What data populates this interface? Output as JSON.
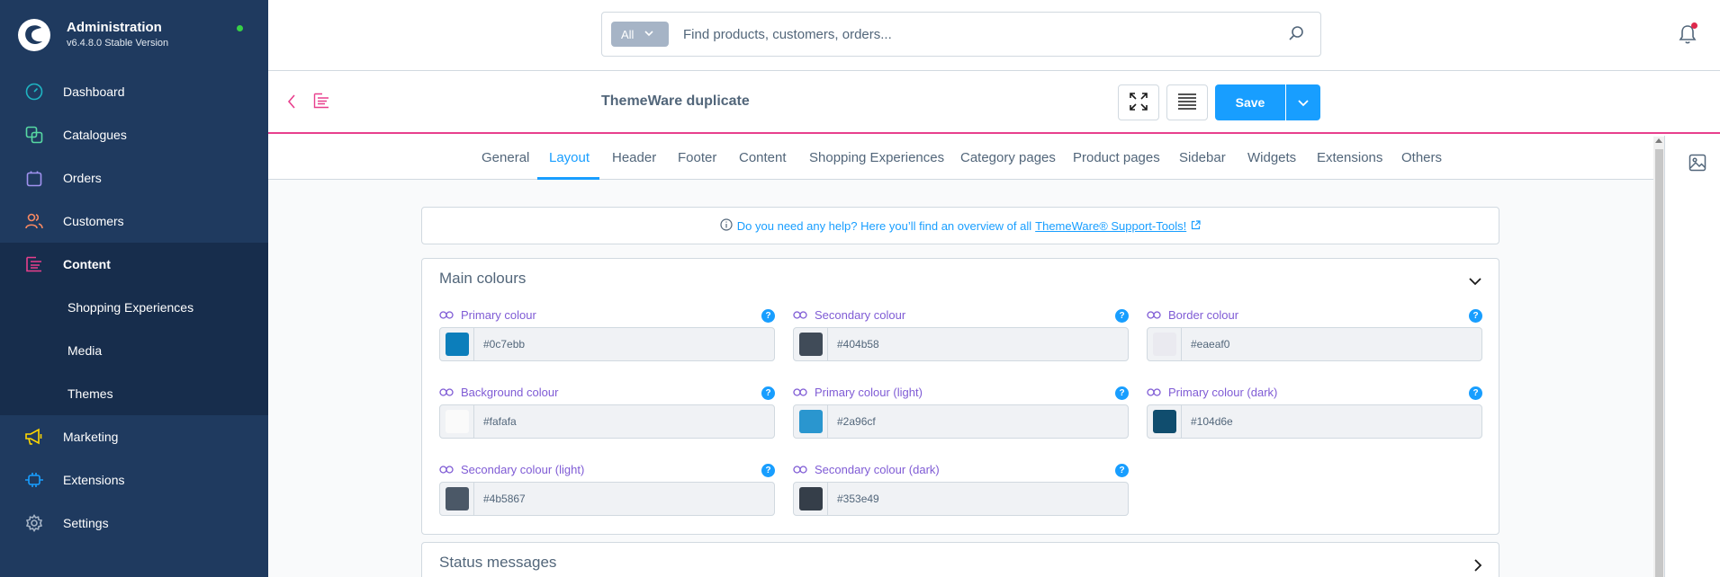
{
  "app": {
    "title": "Administration",
    "version": "v6.4.8.0 Stable Version"
  },
  "sidebar": {
    "items": [
      {
        "label": "Dashboard",
        "icon": "dashboard-icon"
      },
      {
        "label": "Catalogues",
        "icon": "catalogues-icon"
      },
      {
        "label": "Orders",
        "icon": "orders-icon"
      },
      {
        "label": "Customers",
        "icon": "customers-icon"
      },
      {
        "label": "Content",
        "icon": "content-icon"
      },
      {
        "label": "Marketing",
        "icon": "marketing-icon"
      },
      {
        "label": "Extensions",
        "icon": "extensions-icon"
      },
      {
        "label": "Settings",
        "icon": "settings-icon"
      }
    ],
    "content_subitems": [
      "Shopping Experiences",
      "Media",
      "Themes"
    ]
  },
  "search": {
    "scope": "All",
    "placeholder": "Find products, customers, orders..."
  },
  "smartbar": {
    "title": "ThemeWare duplicate",
    "save_label": "Save"
  },
  "tabs": [
    "General",
    "Layout",
    "Header",
    "Footer",
    "Content",
    "Shopping Experiences",
    "Category pages",
    "Product pages",
    "Sidebar",
    "Widgets",
    "Extensions",
    "Others"
  ],
  "active_tab": "Layout",
  "help": {
    "text": "Do you need any help? Here you’ll find an overview of all",
    "link": "ThemeWare® Support-Tools!"
  },
  "main_colours": {
    "title": "Main colours",
    "fields": [
      {
        "label": "Primary colour",
        "value": "#0c7ebb"
      },
      {
        "label": "Secondary colour",
        "value": "#404b58"
      },
      {
        "label": "Border colour",
        "value": "#eaeaf0"
      },
      {
        "label": "Background colour",
        "value": "#fafafa"
      },
      {
        "label": "Primary colour (light)",
        "value": "#2a96cf"
      },
      {
        "label": "Primary colour (dark)",
        "value": "#104d6e"
      },
      {
        "label": "Secondary colour (light)",
        "value": "#4b5867"
      },
      {
        "label": "Secondary colour (dark)",
        "value": "#353e49"
      }
    ]
  },
  "status_messages": {
    "title": "Status messages"
  },
  "colors": {
    "sidebar_bg": "#1f3a5f",
    "accent": "#189eff",
    "content_accent": "#e83f8d",
    "label_purple": "#7f5bd5"
  }
}
